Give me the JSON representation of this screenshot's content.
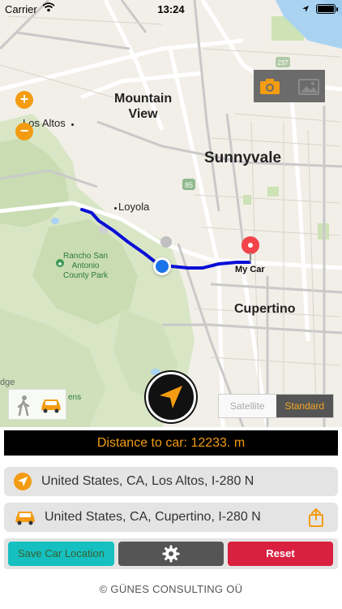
{
  "status_bar": {
    "carrier": "Carrier",
    "time": "13:24"
  },
  "map": {
    "labels": {
      "mountain_view": "Mountain\nView",
      "los_altos": "Los Altos",
      "sunnyvale": "Sunnyvale",
      "loyola": "Loyola",
      "cupertino": "Cupertino",
      "rancho": "Rancho San\nAntonio\nCounty Park",
      "my_car": "My Car",
      "highway_85": "85",
      "highway_237": "237",
      "edge_left": "dge",
      "edge_left2": "ens"
    },
    "zoom_in_label": "+",
    "zoom_out_label": "−",
    "map_type": {
      "options": [
        "Satellite",
        "Standard"
      ],
      "selected": "Standard"
    },
    "route_color": "#0a0fd6",
    "accent_color": "#f39c12"
  },
  "panel": {
    "distance_text": "Distance to car: 12233. m",
    "current_address": "United States, CA, Los Altos, I-280 N",
    "car_address": "United States, CA, Cupertino, I-280 N"
  },
  "buttons": {
    "save": "Save Car Location",
    "reset": "Reset"
  },
  "footer": "© GÜNES CONSULTING OÜ"
}
